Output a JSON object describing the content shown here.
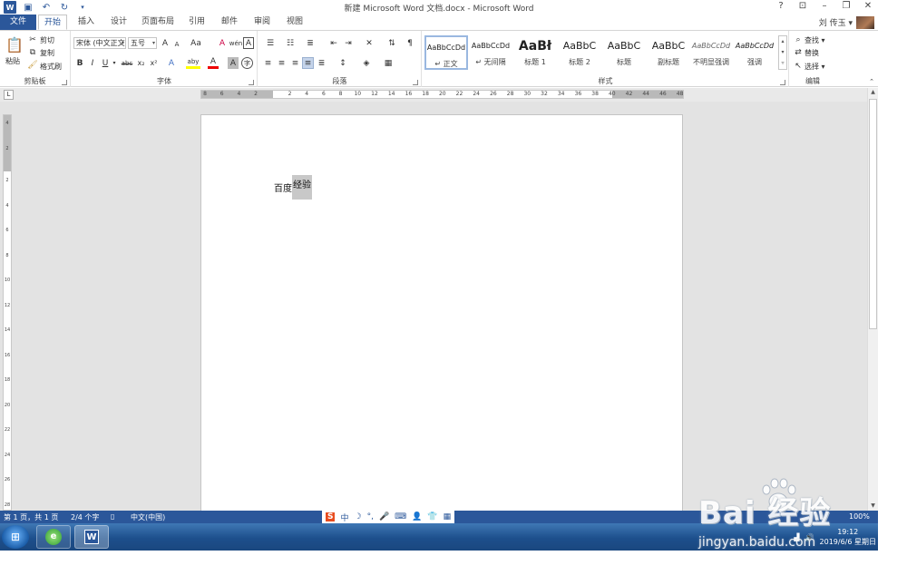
{
  "window": {
    "title": "新建 Microsoft Word 文档.docx - Microsoft Word",
    "help": "?",
    "controls": [
      "ribbon-display",
      "minimize",
      "restore",
      "close"
    ]
  },
  "qat": {
    "word_icon": "W",
    "save_icon": "save-icon",
    "undo_icon": "undo-icon",
    "redo_icon": "redo-icon",
    "customize_icon": "dropdown-icon"
  },
  "tabs": [
    "文件",
    "开始",
    "插入",
    "设计",
    "页面布局",
    "引用",
    "邮件",
    "审阅",
    "视图"
  ],
  "active_tab": "开始",
  "user": {
    "name": "刘 传玉 ▾"
  },
  "ribbon": {
    "clipboard": {
      "label": "剪贴板",
      "paste": "粘贴",
      "cut": "剪切",
      "copy": "复制",
      "format_painter": "格式刷"
    },
    "font": {
      "label": "字体",
      "font_name": "宋体 (中文正文",
      "font_size": "五号",
      "bold": "B",
      "italic": "I",
      "underline": "U",
      "strikethrough": "abc",
      "subscript": "x₂",
      "superscript": "x²",
      "grow": "A",
      "shrink": "A",
      "change_case": "Aa",
      "clear_format": "A",
      "phonetic": "wén",
      "border": "A",
      "text_effect": "A",
      "highlight": "aby",
      "font_color": "A",
      "shading": "A",
      "enclose": "字"
    },
    "paragraph": {
      "label": "段落"
    },
    "styles": {
      "label": "样式",
      "items": [
        {
          "sample": "AaBbCcDd",
          "name": "↵ 正文"
        },
        {
          "sample": "AaBbCcDd",
          "name": "↵ 无间隔"
        },
        {
          "sample": "AaBł",
          "name": "标题 1"
        },
        {
          "sample": "AaBbC",
          "name": "标题 2"
        },
        {
          "sample": "AaBbC",
          "name": "标题"
        },
        {
          "sample": "AaBbC",
          "name": "副标题"
        },
        {
          "sample": "AaBbCcDd",
          "name": "不明显强调"
        },
        {
          "sample": "AaBbCcDd",
          "name": "强调"
        }
      ]
    },
    "editing": {
      "label": "编辑",
      "find": "查找 ▾",
      "replace": "替换",
      "select": "选择 ▾"
    }
  },
  "ruler": {
    "toggle": "L",
    "h_ticks": [
      "8",
      "6",
      "4",
      "2",
      "2",
      "4",
      "6",
      "8",
      "10",
      "12",
      "14",
      "16",
      "18",
      "20",
      "22",
      "24",
      "26",
      "28",
      "30",
      "32",
      "34",
      "36",
      "38",
      "40",
      "42",
      "44",
      "46",
      "48"
    ],
    "v_ticks": [
      "4",
      "2",
      "2",
      "4",
      "6",
      "8",
      "10",
      "12",
      "14",
      "16",
      "18",
      "20",
      "22",
      "24",
      "26",
      "28"
    ]
  },
  "document": {
    "text_plain": "百度",
    "text_selected": "经验"
  },
  "status": {
    "page": "第 1 页，共 1 页",
    "words": "2/4 个字",
    "language": "中文(中国)",
    "zoom": "100%"
  },
  "ime": {
    "logo": "S",
    "mode": "中",
    "icons": [
      "moon-icon",
      "punct-icon",
      "mic-icon",
      "keyboard-icon",
      "user-icon",
      "shirt-icon",
      "grid-icon"
    ]
  },
  "taskbar": {
    "start": "⊞",
    "apps": [
      "ie-icon",
      "word-icon"
    ],
    "time": "19:12",
    "date": "2019/6/6 星期日"
  },
  "watermark": {
    "logo": "Bai  经验",
    "url": "jingyan.baidu.com"
  }
}
